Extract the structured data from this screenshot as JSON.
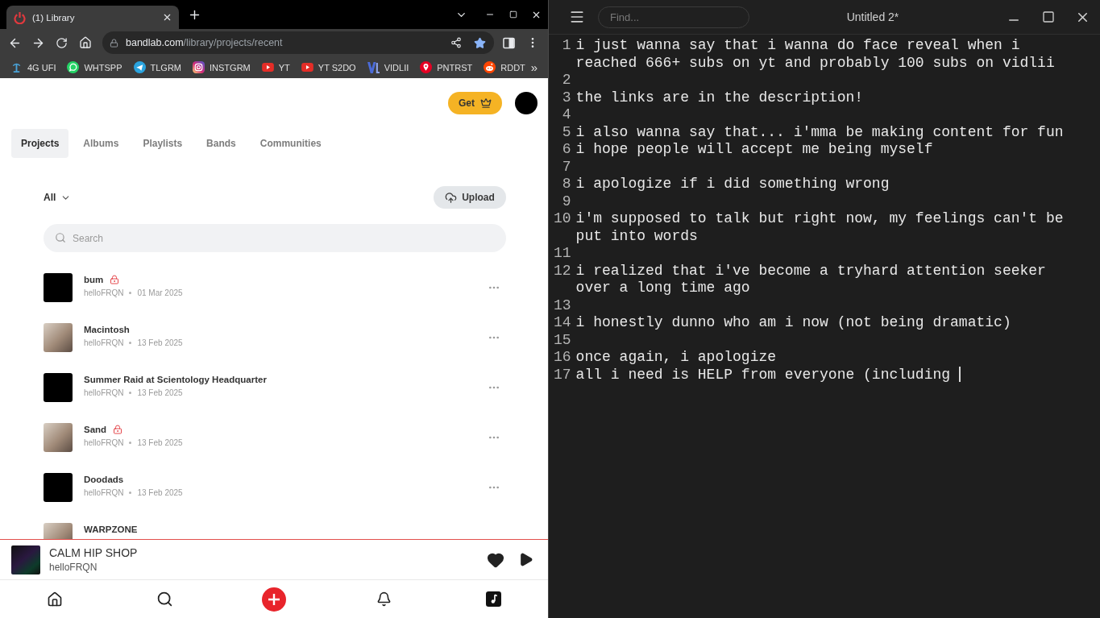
{
  "browser": {
    "tab": {
      "title": "(1) Library"
    },
    "address": {
      "host": "bandlab.com",
      "path": "/library/projects/recent"
    },
    "bookmarks": [
      {
        "label": "4G UFI"
      },
      {
        "label": "WHTSPP"
      },
      {
        "label": "TLGRM"
      },
      {
        "label": "INSTGRM"
      },
      {
        "label": "YT"
      },
      {
        "label": "YT S2DO"
      },
      {
        "label": "VIDLII"
      },
      {
        "label": "PNTRST"
      },
      {
        "label": "RDDT"
      }
    ],
    "bookmarks_more": "»"
  },
  "page": {
    "get_button": "Get",
    "tabs": [
      {
        "label": "Projects",
        "selected": true
      },
      {
        "label": "Albums",
        "selected": false
      },
      {
        "label": "Playlists",
        "selected": false
      },
      {
        "label": "Bands",
        "selected": false
      },
      {
        "label": "Communities",
        "selected": false
      }
    ],
    "filter": "All",
    "upload_button": "Upload",
    "search": {
      "placeholder": "Search"
    },
    "projects": [
      {
        "kind": "plain",
        "title": "bum",
        "locked": true,
        "owner": "helloFRQN",
        "date": "01 Mar 2025"
      },
      {
        "kind": "photo",
        "title": "Macintosh",
        "locked": false,
        "owner": "helloFRQN",
        "date": "13 Feb 2025"
      },
      {
        "kind": "plain",
        "title": "Summer Raid at Scientology Headquarter",
        "locked": false,
        "owner": "helloFRQN",
        "date": "13 Feb 2025"
      },
      {
        "kind": "photo",
        "title": "Sand",
        "locked": true,
        "owner": "helloFRQN",
        "date": "13 Feb 2025"
      },
      {
        "kind": "plain",
        "title": "Doodads",
        "locked": false,
        "owner": "helloFRQN",
        "date": "13 Feb 2025"
      },
      {
        "kind": "photo",
        "title": "WARPZONE",
        "locked": false
      }
    ],
    "now_playing": {
      "title": "CALM HIP SHOP",
      "artist": "helloFRQN"
    }
  },
  "editor": {
    "find": {
      "placeholder": "Find..."
    },
    "title": "Untitled 2*",
    "lines": [
      {
        "number": "1",
        "text": "i just wanna say that i wanna do face reveal when i reached 666+ subs on yt and probably 100 subs on vidlii",
        "cursor": false
      },
      {
        "number": "2",
        "cursor": false
      },
      {
        "number": "3",
        "text": "the links are in the description!",
        "cursor": false
      },
      {
        "number": "4",
        "cursor": false
      },
      {
        "number": "5",
        "text": "i also wanna say that... i'mma be making content for fun",
        "cursor": false
      },
      {
        "number": "6",
        "text": "i hope people will accept me being myself",
        "cursor": false
      },
      {
        "number": "7",
        "cursor": false
      },
      {
        "number": "8",
        "text": "i apologize if i did something wrong",
        "cursor": false
      },
      {
        "number": "9",
        "cursor": false
      },
      {
        "number": "10",
        "text": "i'm supposed to talk but right now, my feelings can't be put into words",
        "cursor": false
      },
      {
        "number": "11",
        "cursor": false
      },
      {
        "number": "12",
        "text": "i realized that i've become a tryhard attention seeker over a long time ago",
        "cursor": false
      },
      {
        "number": "13",
        "cursor": false
      },
      {
        "number": "14",
        "text": "i honestly dunno who am i now (not being dramatic)",
        "cursor": false
      },
      {
        "number": "15",
        "cursor": false
      },
      {
        "number": "16",
        "text": "once again, i apologize",
        "cursor": false
      },
      {
        "number": "17",
        "text": "all i need is HELP from everyone (including",
        "cursor": true
      }
    ]
  }
}
